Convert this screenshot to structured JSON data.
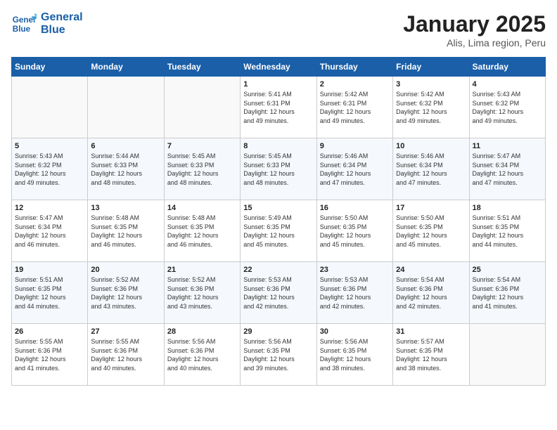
{
  "header": {
    "logo_line1": "General",
    "logo_line2": "Blue",
    "title": "January 2025",
    "subtitle": "Alis, Lima region, Peru"
  },
  "weekdays": [
    "Sunday",
    "Monday",
    "Tuesday",
    "Wednesday",
    "Thursday",
    "Friday",
    "Saturday"
  ],
  "weeks": [
    [
      {
        "day": "",
        "info": ""
      },
      {
        "day": "",
        "info": ""
      },
      {
        "day": "",
        "info": ""
      },
      {
        "day": "1",
        "info": "Sunrise: 5:41 AM\nSunset: 6:31 PM\nDaylight: 12 hours\nand 49 minutes."
      },
      {
        "day": "2",
        "info": "Sunrise: 5:42 AM\nSunset: 6:31 PM\nDaylight: 12 hours\nand 49 minutes."
      },
      {
        "day": "3",
        "info": "Sunrise: 5:42 AM\nSunset: 6:32 PM\nDaylight: 12 hours\nand 49 minutes."
      },
      {
        "day": "4",
        "info": "Sunrise: 5:43 AM\nSunset: 6:32 PM\nDaylight: 12 hours\nand 49 minutes."
      }
    ],
    [
      {
        "day": "5",
        "info": "Sunrise: 5:43 AM\nSunset: 6:32 PM\nDaylight: 12 hours\nand 49 minutes."
      },
      {
        "day": "6",
        "info": "Sunrise: 5:44 AM\nSunset: 6:33 PM\nDaylight: 12 hours\nand 48 minutes."
      },
      {
        "day": "7",
        "info": "Sunrise: 5:45 AM\nSunset: 6:33 PM\nDaylight: 12 hours\nand 48 minutes."
      },
      {
        "day": "8",
        "info": "Sunrise: 5:45 AM\nSunset: 6:33 PM\nDaylight: 12 hours\nand 48 minutes."
      },
      {
        "day": "9",
        "info": "Sunrise: 5:46 AM\nSunset: 6:34 PM\nDaylight: 12 hours\nand 47 minutes."
      },
      {
        "day": "10",
        "info": "Sunrise: 5:46 AM\nSunset: 6:34 PM\nDaylight: 12 hours\nand 47 minutes."
      },
      {
        "day": "11",
        "info": "Sunrise: 5:47 AM\nSunset: 6:34 PM\nDaylight: 12 hours\nand 47 minutes."
      }
    ],
    [
      {
        "day": "12",
        "info": "Sunrise: 5:47 AM\nSunset: 6:34 PM\nDaylight: 12 hours\nand 46 minutes."
      },
      {
        "day": "13",
        "info": "Sunrise: 5:48 AM\nSunset: 6:35 PM\nDaylight: 12 hours\nand 46 minutes."
      },
      {
        "day": "14",
        "info": "Sunrise: 5:48 AM\nSunset: 6:35 PM\nDaylight: 12 hours\nand 46 minutes."
      },
      {
        "day": "15",
        "info": "Sunrise: 5:49 AM\nSunset: 6:35 PM\nDaylight: 12 hours\nand 45 minutes."
      },
      {
        "day": "16",
        "info": "Sunrise: 5:50 AM\nSunset: 6:35 PM\nDaylight: 12 hours\nand 45 minutes."
      },
      {
        "day": "17",
        "info": "Sunrise: 5:50 AM\nSunset: 6:35 PM\nDaylight: 12 hours\nand 45 minutes."
      },
      {
        "day": "18",
        "info": "Sunrise: 5:51 AM\nSunset: 6:35 PM\nDaylight: 12 hours\nand 44 minutes."
      }
    ],
    [
      {
        "day": "19",
        "info": "Sunrise: 5:51 AM\nSunset: 6:35 PM\nDaylight: 12 hours\nand 44 minutes."
      },
      {
        "day": "20",
        "info": "Sunrise: 5:52 AM\nSunset: 6:36 PM\nDaylight: 12 hours\nand 43 minutes."
      },
      {
        "day": "21",
        "info": "Sunrise: 5:52 AM\nSunset: 6:36 PM\nDaylight: 12 hours\nand 43 minutes."
      },
      {
        "day": "22",
        "info": "Sunrise: 5:53 AM\nSunset: 6:36 PM\nDaylight: 12 hours\nand 42 minutes."
      },
      {
        "day": "23",
        "info": "Sunrise: 5:53 AM\nSunset: 6:36 PM\nDaylight: 12 hours\nand 42 minutes."
      },
      {
        "day": "24",
        "info": "Sunrise: 5:54 AM\nSunset: 6:36 PM\nDaylight: 12 hours\nand 42 minutes."
      },
      {
        "day": "25",
        "info": "Sunrise: 5:54 AM\nSunset: 6:36 PM\nDaylight: 12 hours\nand 41 minutes."
      }
    ],
    [
      {
        "day": "26",
        "info": "Sunrise: 5:55 AM\nSunset: 6:36 PM\nDaylight: 12 hours\nand 41 minutes."
      },
      {
        "day": "27",
        "info": "Sunrise: 5:55 AM\nSunset: 6:36 PM\nDaylight: 12 hours\nand 40 minutes."
      },
      {
        "day": "28",
        "info": "Sunrise: 5:56 AM\nSunset: 6:36 PM\nDaylight: 12 hours\nand 40 minutes."
      },
      {
        "day": "29",
        "info": "Sunrise: 5:56 AM\nSunset: 6:35 PM\nDaylight: 12 hours\nand 39 minutes."
      },
      {
        "day": "30",
        "info": "Sunrise: 5:56 AM\nSunset: 6:35 PM\nDaylight: 12 hours\nand 38 minutes."
      },
      {
        "day": "31",
        "info": "Sunrise: 5:57 AM\nSunset: 6:35 PM\nDaylight: 12 hours\nand 38 minutes."
      },
      {
        "day": "",
        "info": ""
      }
    ]
  ]
}
